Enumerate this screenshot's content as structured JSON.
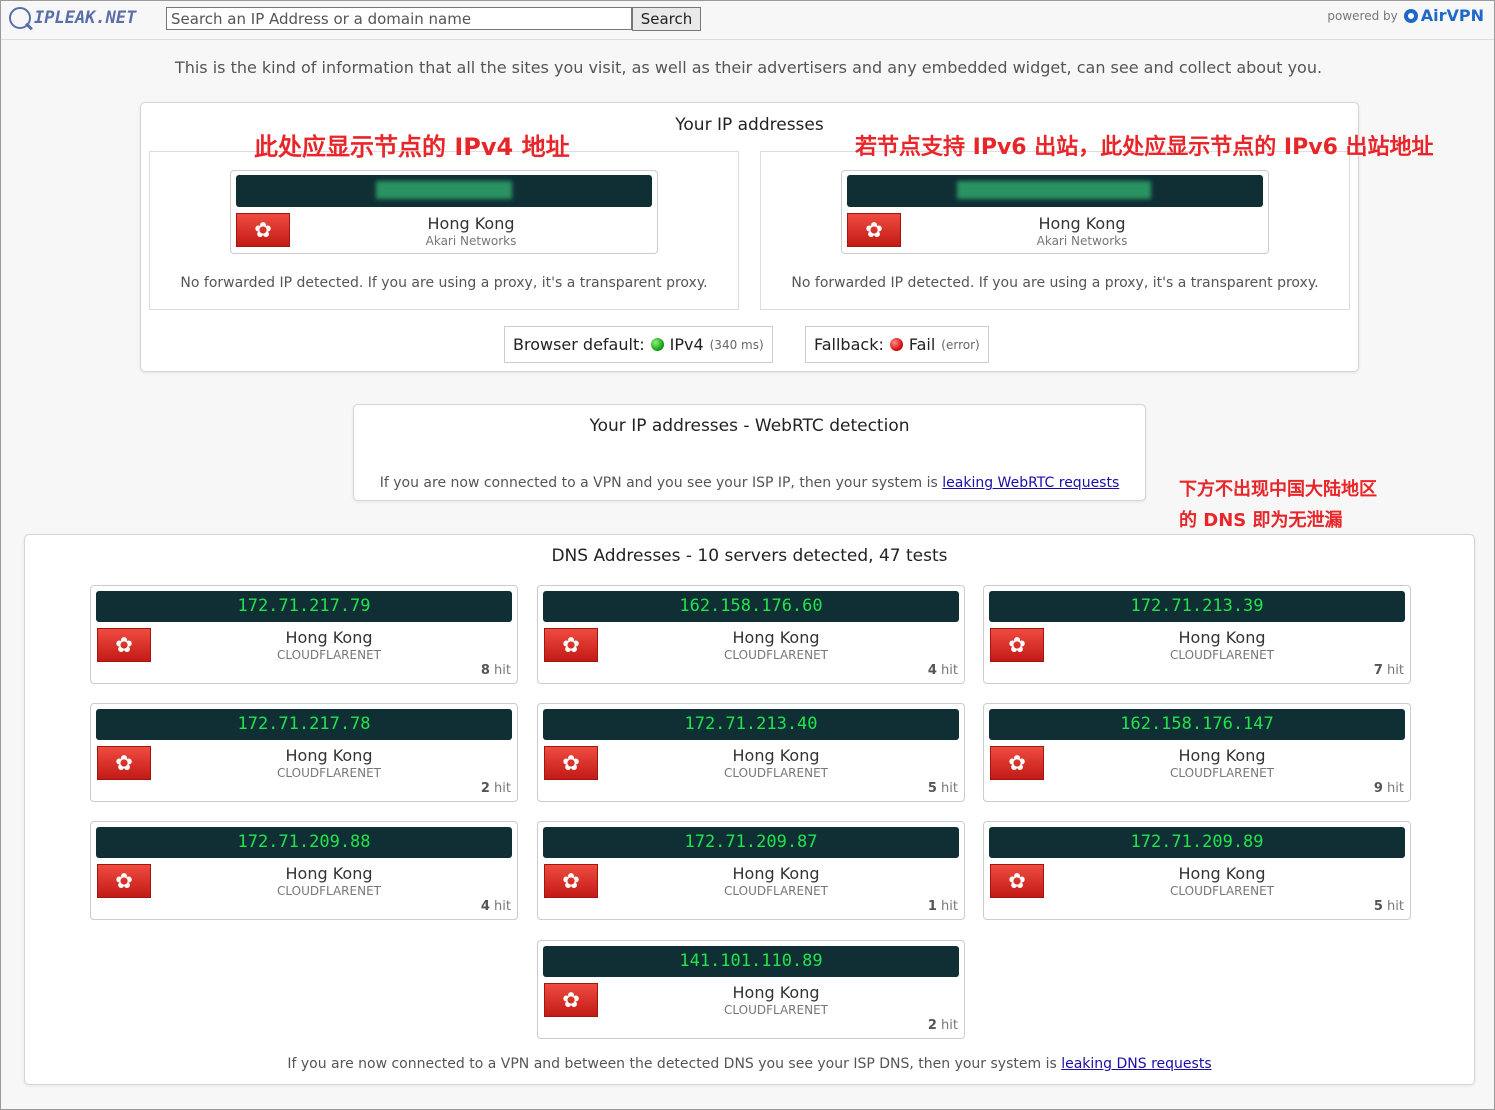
{
  "topbar": {
    "logo_text": "IPLEAK.NET",
    "search_placeholder": "Search an IP Address or a domain name",
    "search_button": "Search",
    "powered_by": "powered by",
    "brand": "AirVPN"
  },
  "intro": "This is the kind of information that all the sites you visit, as well as their advertisers and any embedded widget, can see and collect about you.",
  "ip_section": {
    "title": "Your IP addresses",
    "annotation_ipv4": "此处应显示节点的 IPv4 地址",
    "annotation_ipv6": "若节点支持 IPv6 出站，此处应显示节点的 IPv6 出站地址",
    "entries": [
      {
        "city": "Hong Kong",
        "isp": "Akari Networks",
        "forward_note": "No forwarded IP detected. If you are using a proxy, it's a transparent proxy."
      },
      {
        "city": "Hong Kong",
        "isp": "Akari Networks",
        "forward_note": "No forwarded IP detected. If you are using a proxy, it's a transparent proxy."
      }
    ],
    "browser_default": {
      "label": "Browser default:",
      "value": "IPv4",
      "detail": "(340 ms)",
      "status_color": "#12a012"
    },
    "fallback": {
      "label": "Fallback:",
      "value": "Fail",
      "detail": "(error)",
      "status_color": "#d20b0b"
    }
  },
  "webrtc": {
    "title": "Your IP addresses - WebRTC detection",
    "note": "If you are now connected to a VPN and you see your ISP IP, then your system is",
    "link": "leaking WebRTC requests"
  },
  "annotation_dns": [
    "下方不出现中国大陆地区",
    "的 DNS 即为无泄漏"
  ],
  "dns": {
    "title": "DNS Addresses - 10 servers detected, 47 tests",
    "hit_suffix": "hit",
    "servers": [
      {
        "ip": "172.71.217.79",
        "city": "Hong Kong",
        "isp": "CLOUDFLARENET",
        "hits": "8"
      },
      {
        "ip": "162.158.176.60",
        "city": "Hong Kong",
        "isp": "CLOUDFLARENET",
        "hits": "4"
      },
      {
        "ip": "172.71.213.39",
        "city": "Hong Kong",
        "isp": "CLOUDFLARENET",
        "hits": "7"
      },
      {
        "ip": "172.71.217.78",
        "city": "Hong Kong",
        "isp": "CLOUDFLARENET",
        "hits": "2"
      },
      {
        "ip": "172.71.213.40",
        "city": "Hong Kong",
        "isp": "CLOUDFLARENET",
        "hits": "5"
      },
      {
        "ip": "162.158.176.147",
        "city": "Hong Kong",
        "isp": "CLOUDFLARENET",
        "hits": "9"
      },
      {
        "ip": "172.71.209.88",
        "city": "Hong Kong",
        "isp": "CLOUDFLARENET",
        "hits": "4"
      },
      {
        "ip": "172.71.209.87",
        "city": "Hong Kong",
        "isp": "CLOUDFLARENET",
        "hits": "1"
      },
      {
        "ip": "172.71.209.89",
        "city": "Hong Kong",
        "isp": "CLOUDFLARENET",
        "hits": "5"
      },
      {
        "ip": "141.101.110.89",
        "city": "Hong Kong",
        "isp": "CLOUDFLARENET",
        "hits": "2"
      }
    ],
    "note": "If you are now connected to a VPN and between the detected DNS you see your ISP DNS, then your system is",
    "link": "leaking DNS requests"
  },
  "icons": {
    "flag": "hong-kong-flag-icon",
    "logo": "magnifier-logo-icon",
    "brand": "airvpn-logo-icon"
  }
}
